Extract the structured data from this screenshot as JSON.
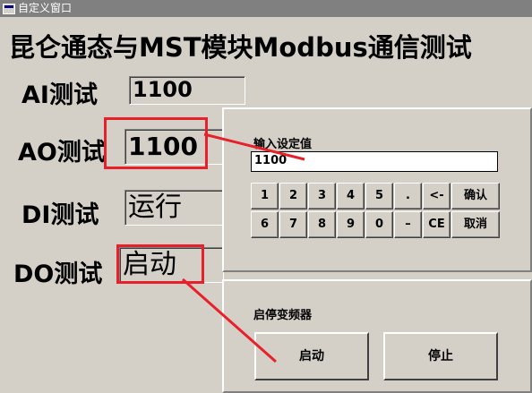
{
  "window": {
    "title": "自定义窗口"
  },
  "heading": "昆仑通态与MST模块Modbus通信测试",
  "rows": [
    {
      "label": "AI测试",
      "value": "1100"
    },
    {
      "label": "AO测试",
      "value": "1100"
    },
    {
      "label": "DI测试",
      "value": "运行"
    },
    {
      "label": "DO测试",
      "value": "启动"
    }
  ],
  "keypad": {
    "title": "输入设定值",
    "input_value": "1100",
    "keys_row1": [
      "1",
      "2",
      "3",
      "4",
      "5",
      ".",
      "<-",
      "确认"
    ],
    "keys_row2": [
      "6",
      "7",
      "8",
      "9",
      "0",
      "–",
      "CE",
      "取消"
    ]
  },
  "vfd_panel": {
    "title": "启停变频器",
    "start_label": "启动",
    "stop_label": "停止"
  },
  "colors": {
    "highlight": "#e8202a",
    "background": "#d4d0c8"
  }
}
